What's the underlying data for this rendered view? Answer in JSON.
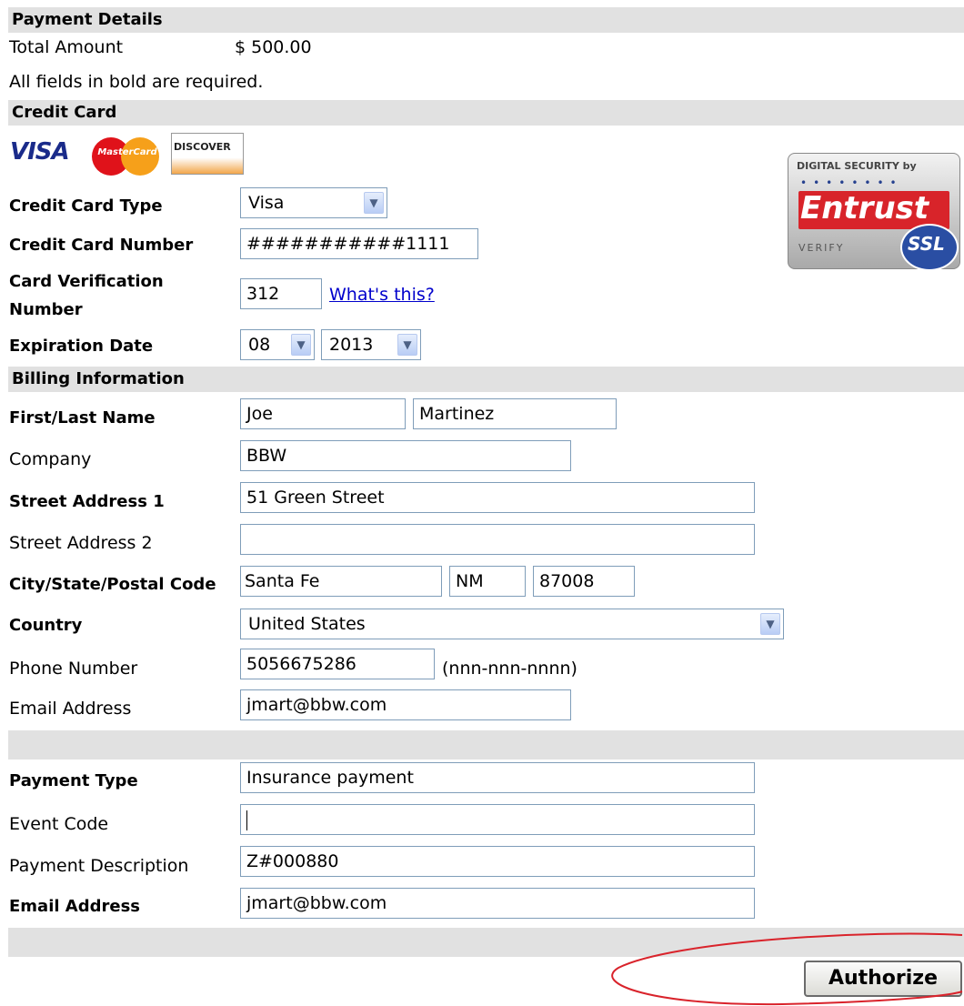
{
  "header": {
    "payment_details": "Payment Details",
    "credit_card": "Credit Card",
    "billing_information": "Billing Information"
  },
  "summary": {
    "total_amount_label": "Total Amount",
    "total_amount_value": "$ 500.00",
    "required_note": "All fields in bold are required."
  },
  "card_logos": {
    "visa": "VISA",
    "mastercard": "MasterCard",
    "discover": "DISCOVER"
  },
  "ssl_badge": {
    "top": "DIGITAL SECURITY by",
    "brand": "Entrust",
    "verify": "VERIFY",
    "ssl": "SSL"
  },
  "credit_card": {
    "type_label": "Credit Card Type",
    "type_value": "Visa",
    "number_label": "Credit Card Number",
    "number_value": "###########1111",
    "cvv_label_line1": "Card Verification",
    "cvv_label_line2": "Number",
    "cvv_value": "312",
    "whats_this": "What's this?",
    "exp_label": "Expiration Date",
    "exp_month": "08",
    "exp_year": "2013"
  },
  "billing": {
    "name_label": "First/Last Name",
    "first_name": "Joe",
    "last_name": "Martinez",
    "company_label": "Company",
    "company_value": "BBW",
    "street1_label": "Street Address 1",
    "street1_value": "51 Green Street",
    "street2_label": "Street Address 2",
    "street2_value": "",
    "city_label": "City/State/Postal Code",
    "city_value": "Santa Fe",
    "state_value": "NM",
    "zip_value": "87008",
    "country_label": "Country",
    "country_value": "United States",
    "phone_label": "Phone Number",
    "phone_value": "5056675286",
    "phone_hint": "(nnn-nnn-nnnn)",
    "email_label": "Email Address",
    "email_value": "jmart@bbw.com"
  },
  "payment": {
    "type_label": "Payment Type",
    "type_value": "Insurance payment",
    "event_label": "Event Code",
    "event_value": "",
    "desc_label": "Payment Description",
    "desc_value": "Z#000880",
    "email_label": "Email Address",
    "email_value": "jmart@bbw.com"
  },
  "actions": {
    "authorize": "Authorize"
  },
  "colors": {
    "section_bg": "#e1e1e1",
    "input_border": "#7f9db9",
    "link": "#0000cc",
    "annotation": "#d9232b"
  }
}
